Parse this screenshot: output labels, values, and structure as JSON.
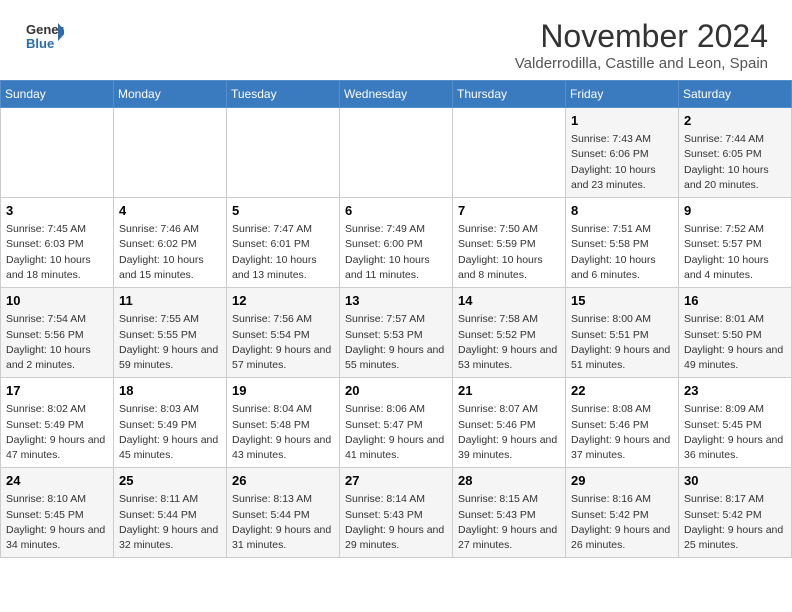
{
  "header": {
    "logo_general": "General",
    "logo_blue": "Blue",
    "month_title": "November 2024",
    "location": "Valderrodilla, Castille and Leon, Spain"
  },
  "days_of_week": [
    "Sunday",
    "Monday",
    "Tuesday",
    "Wednesday",
    "Thursday",
    "Friday",
    "Saturday"
  ],
  "weeks": [
    [
      {
        "day": "",
        "info": ""
      },
      {
        "day": "",
        "info": ""
      },
      {
        "day": "",
        "info": ""
      },
      {
        "day": "",
        "info": ""
      },
      {
        "day": "",
        "info": ""
      },
      {
        "day": "1",
        "info": "Sunrise: 7:43 AM\nSunset: 6:06 PM\nDaylight: 10 hours and 23 minutes."
      },
      {
        "day": "2",
        "info": "Sunrise: 7:44 AM\nSunset: 6:05 PM\nDaylight: 10 hours and 20 minutes."
      }
    ],
    [
      {
        "day": "3",
        "info": "Sunrise: 7:45 AM\nSunset: 6:03 PM\nDaylight: 10 hours and 18 minutes."
      },
      {
        "day": "4",
        "info": "Sunrise: 7:46 AM\nSunset: 6:02 PM\nDaylight: 10 hours and 15 minutes."
      },
      {
        "day": "5",
        "info": "Sunrise: 7:47 AM\nSunset: 6:01 PM\nDaylight: 10 hours and 13 minutes."
      },
      {
        "day": "6",
        "info": "Sunrise: 7:49 AM\nSunset: 6:00 PM\nDaylight: 10 hours and 11 minutes."
      },
      {
        "day": "7",
        "info": "Sunrise: 7:50 AM\nSunset: 5:59 PM\nDaylight: 10 hours and 8 minutes."
      },
      {
        "day": "8",
        "info": "Sunrise: 7:51 AM\nSunset: 5:58 PM\nDaylight: 10 hours and 6 minutes."
      },
      {
        "day": "9",
        "info": "Sunrise: 7:52 AM\nSunset: 5:57 PM\nDaylight: 10 hours and 4 minutes."
      }
    ],
    [
      {
        "day": "10",
        "info": "Sunrise: 7:54 AM\nSunset: 5:56 PM\nDaylight: 10 hours and 2 minutes."
      },
      {
        "day": "11",
        "info": "Sunrise: 7:55 AM\nSunset: 5:55 PM\nDaylight: 9 hours and 59 minutes."
      },
      {
        "day": "12",
        "info": "Sunrise: 7:56 AM\nSunset: 5:54 PM\nDaylight: 9 hours and 57 minutes."
      },
      {
        "day": "13",
        "info": "Sunrise: 7:57 AM\nSunset: 5:53 PM\nDaylight: 9 hours and 55 minutes."
      },
      {
        "day": "14",
        "info": "Sunrise: 7:58 AM\nSunset: 5:52 PM\nDaylight: 9 hours and 53 minutes."
      },
      {
        "day": "15",
        "info": "Sunrise: 8:00 AM\nSunset: 5:51 PM\nDaylight: 9 hours and 51 minutes."
      },
      {
        "day": "16",
        "info": "Sunrise: 8:01 AM\nSunset: 5:50 PM\nDaylight: 9 hours and 49 minutes."
      }
    ],
    [
      {
        "day": "17",
        "info": "Sunrise: 8:02 AM\nSunset: 5:49 PM\nDaylight: 9 hours and 47 minutes."
      },
      {
        "day": "18",
        "info": "Sunrise: 8:03 AM\nSunset: 5:49 PM\nDaylight: 9 hours and 45 minutes."
      },
      {
        "day": "19",
        "info": "Sunrise: 8:04 AM\nSunset: 5:48 PM\nDaylight: 9 hours and 43 minutes."
      },
      {
        "day": "20",
        "info": "Sunrise: 8:06 AM\nSunset: 5:47 PM\nDaylight: 9 hours and 41 minutes."
      },
      {
        "day": "21",
        "info": "Sunrise: 8:07 AM\nSunset: 5:46 PM\nDaylight: 9 hours and 39 minutes."
      },
      {
        "day": "22",
        "info": "Sunrise: 8:08 AM\nSunset: 5:46 PM\nDaylight: 9 hours and 37 minutes."
      },
      {
        "day": "23",
        "info": "Sunrise: 8:09 AM\nSunset: 5:45 PM\nDaylight: 9 hours and 36 minutes."
      }
    ],
    [
      {
        "day": "24",
        "info": "Sunrise: 8:10 AM\nSunset: 5:45 PM\nDaylight: 9 hours and 34 minutes."
      },
      {
        "day": "25",
        "info": "Sunrise: 8:11 AM\nSunset: 5:44 PM\nDaylight: 9 hours and 32 minutes."
      },
      {
        "day": "26",
        "info": "Sunrise: 8:13 AM\nSunset: 5:44 PM\nDaylight: 9 hours and 31 minutes."
      },
      {
        "day": "27",
        "info": "Sunrise: 8:14 AM\nSunset: 5:43 PM\nDaylight: 9 hours and 29 minutes."
      },
      {
        "day": "28",
        "info": "Sunrise: 8:15 AM\nSunset: 5:43 PM\nDaylight: 9 hours and 27 minutes."
      },
      {
        "day": "29",
        "info": "Sunrise: 8:16 AM\nSunset: 5:42 PM\nDaylight: 9 hours and 26 minutes."
      },
      {
        "day": "30",
        "info": "Sunrise: 8:17 AM\nSunset: 5:42 PM\nDaylight: 9 hours and 25 minutes."
      }
    ]
  ]
}
